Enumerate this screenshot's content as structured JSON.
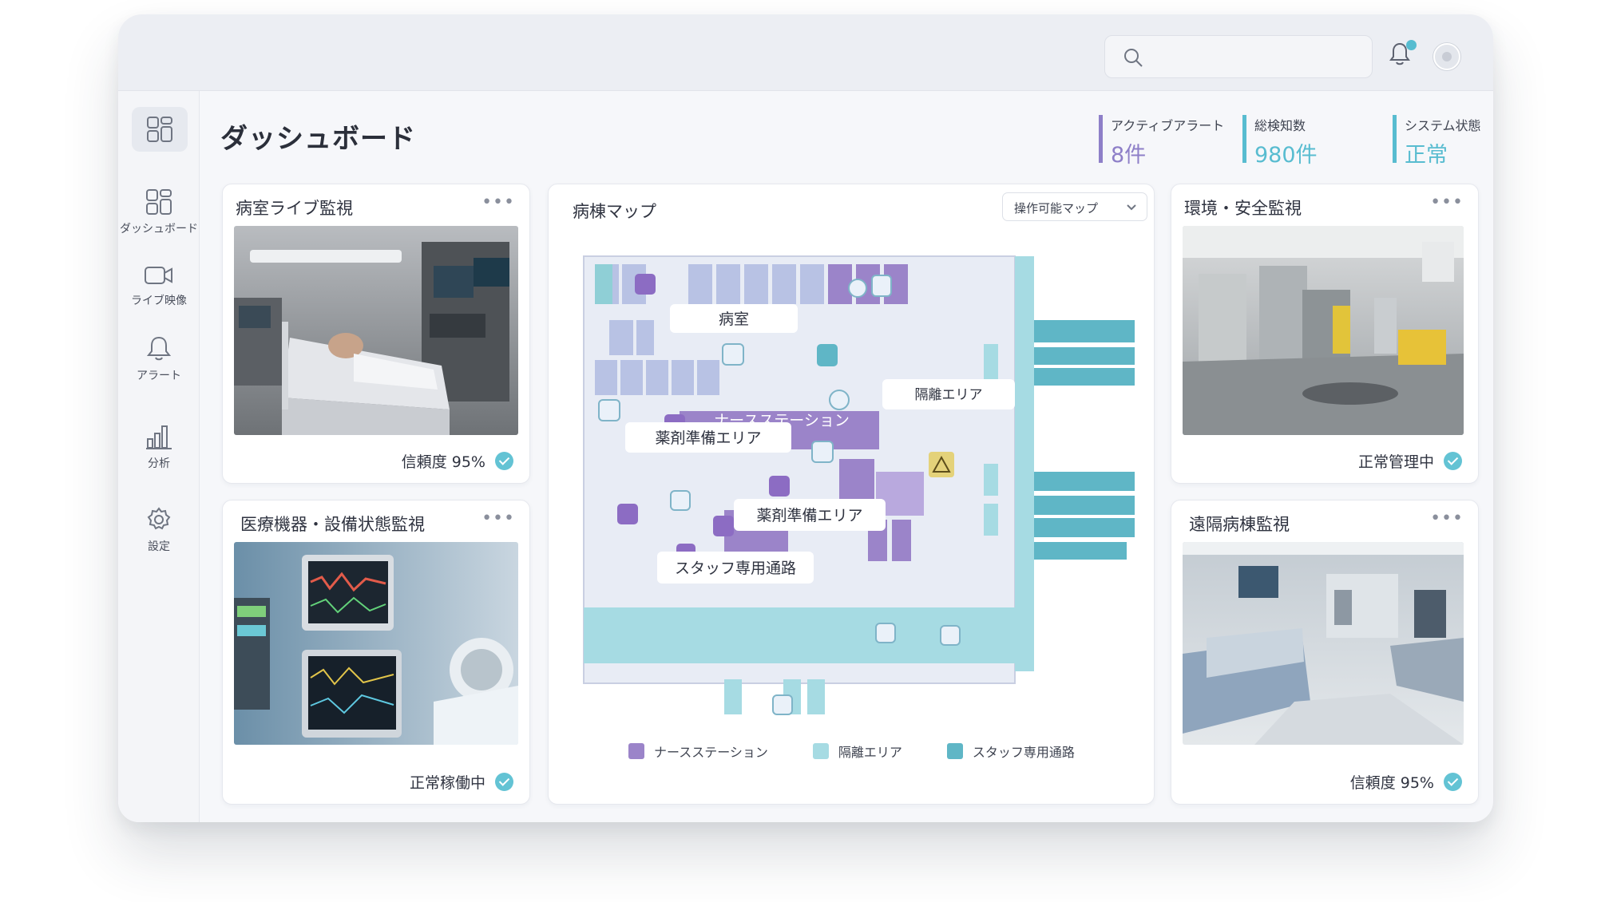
{
  "header": {
    "search": {
      "placeholder": ""
    }
  },
  "sidebar": {
    "items": [
      {
        "label": "ダッシュボード",
        "icon": "dashboard-icon"
      },
      {
        "label": "ライブ映像",
        "icon": "video-camera-icon"
      },
      {
        "label": "アラート",
        "icon": "bell-icon"
      },
      {
        "label": "分析",
        "icon": "bar-chart-icon"
      },
      {
        "label": "設定",
        "icon": "gear-icon"
      }
    ]
  },
  "page": {
    "title": "ダッシュボード"
  },
  "stats": [
    {
      "label": "アクティブアラート",
      "value": "8件",
      "color": "#8e7fc8"
    },
    {
      "label": "総検知数",
      "value": "980件",
      "color": "#58bcd0"
    },
    {
      "label": "システム状態",
      "value": "正常",
      "color": "#58bcd0"
    }
  ],
  "cards": {
    "ward_live": {
      "title": "病室ライブ監視",
      "status": "信頼度 95%"
    },
    "equipment": {
      "title": "医療機器・設備状態監視",
      "status": "正常稼働中"
    },
    "environment": {
      "title": "環境・安全監視",
      "status": "正常管理中"
    },
    "remote": {
      "title": "遠隔病棟監視",
      "status": "信頼度 95%"
    }
  },
  "map": {
    "title": "病棟マップ",
    "selector": "操作可能マップ",
    "labels": {
      "room": "病室",
      "nurse": "ナースステーション",
      "isolation": "隔離エリア",
      "pharmacy1": "薬剤準備エリア",
      "pharmacy2": "薬剤準備エリア",
      "staff": "スタッフ専用通路"
    },
    "legend": [
      {
        "label": "ナースステーション",
        "color": "#9b84c9"
      },
      {
        "label": "隔離エリア",
        "color": "#a6dbe3"
      },
      {
        "label": "スタッフ専用通路",
        "color": "#5fb6c6"
      }
    ]
  },
  "colors": {
    "accent_purple": "#8e7fc8",
    "accent_teal": "#58bcd0"
  }
}
